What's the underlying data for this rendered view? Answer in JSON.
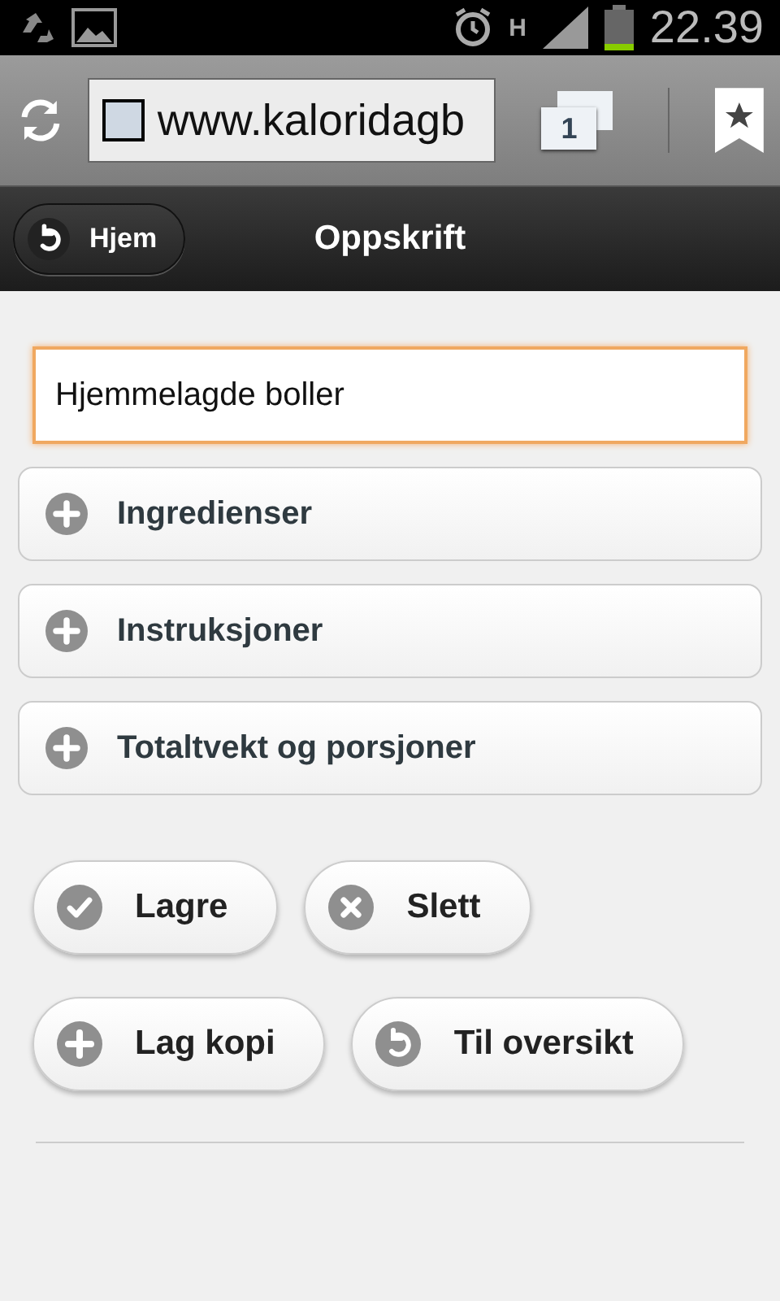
{
  "status_bar": {
    "network": "H",
    "time": "22.39"
  },
  "browser": {
    "url": "www.kaloridagb",
    "tab_count": "1"
  },
  "header": {
    "back_button": "Hjem",
    "title": "Oppskrift"
  },
  "name_field": {
    "value": "Hjemmelagde boller",
    "focused": true
  },
  "sections": [
    {
      "label": "Ingredienser",
      "expanded": false
    },
    {
      "label": "Instruksjoner",
      "expanded": false
    },
    {
      "label": "Totaltvekt og porsjoner",
      "expanded": false
    }
  ],
  "action_rows": [
    [
      {
        "label": "Lagre",
        "kind": "check"
      },
      {
        "label": "Slett",
        "kind": "delete"
      }
    ],
    [
      {
        "label": "Lag kopi",
        "kind": "plus"
      },
      {
        "label": "Til oversikt",
        "kind": "back"
      }
    ]
  ]
}
